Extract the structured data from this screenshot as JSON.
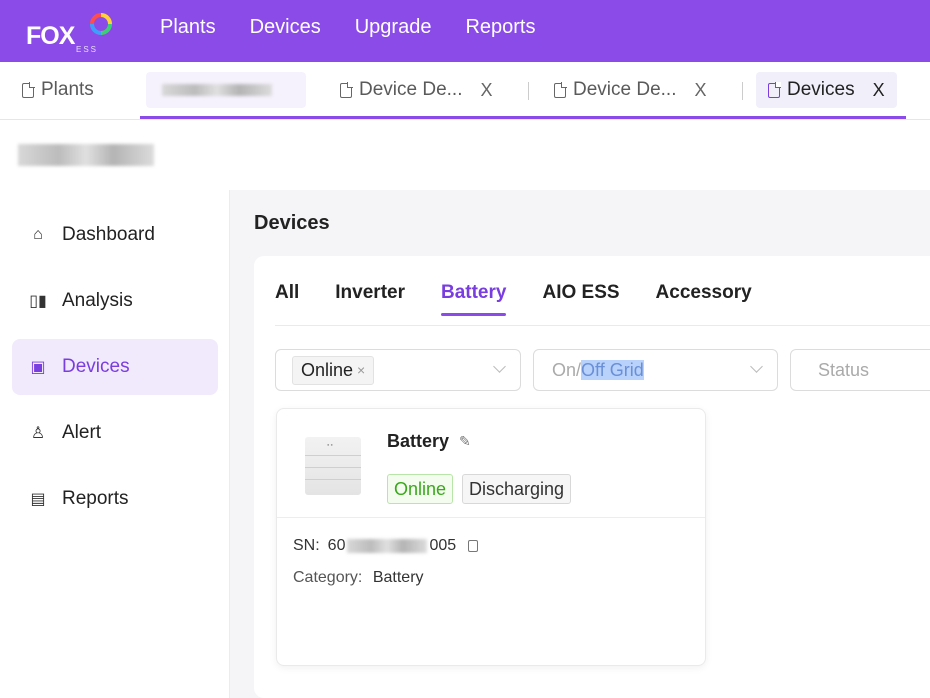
{
  "brand": {
    "name": "FOX",
    "sub": "ESS"
  },
  "nav": {
    "items": [
      "Plants",
      "Devices",
      "Upgrade",
      "Reports"
    ]
  },
  "tabs": [
    {
      "label": "Plants"
    },
    {
      "label": "Device De...",
      "close": "X"
    },
    {
      "label": "Device De...",
      "close": "X"
    },
    {
      "label": "Devices",
      "close": "X"
    }
  ],
  "sidebar": {
    "items": [
      {
        "label": "Dashboard",
        "icon": "home-icon"
      },
      {
        "label": "Analysis",
        "icon": "analysis-icon"
      },
      {
        "label": "Devices",
        "icon": "devices-icon"
      },
      {
        "label": "Alert",
        "icon": "alert-icon"
      },
      {
        "label": "Reports",
        "icon": "reports-icon"
      }
    ]
  },
  "main": {
    "title": "Devices",
    "filter_tabs": [
      "All",
      "Inverter",
      "Battery",
      "AIO ESS",
      "Accessory"
    ],
    "filters": {
      "status_chip": "Online",
      "chip_remove": "×",
      "grid_placeholder_a": "On/",
      "grid_placeholder_b": "Off Grid",
      "status_placeholder": "Status"
    },
    "card": {
      "name": "Battery",
      "edit_icon": "⁄",
      "status": "Online",
      "state": "Discharging",
      "sn_label": "SN:",
      "sn_prefix": "60",
      "sn_suffix": "005",
      "category_label": "Category:",
      "category_value": "Battery"
    }
  },
  "colors": {
    "accent": "#8b4be8",
    "online": "#3aa81c"
  }
}
